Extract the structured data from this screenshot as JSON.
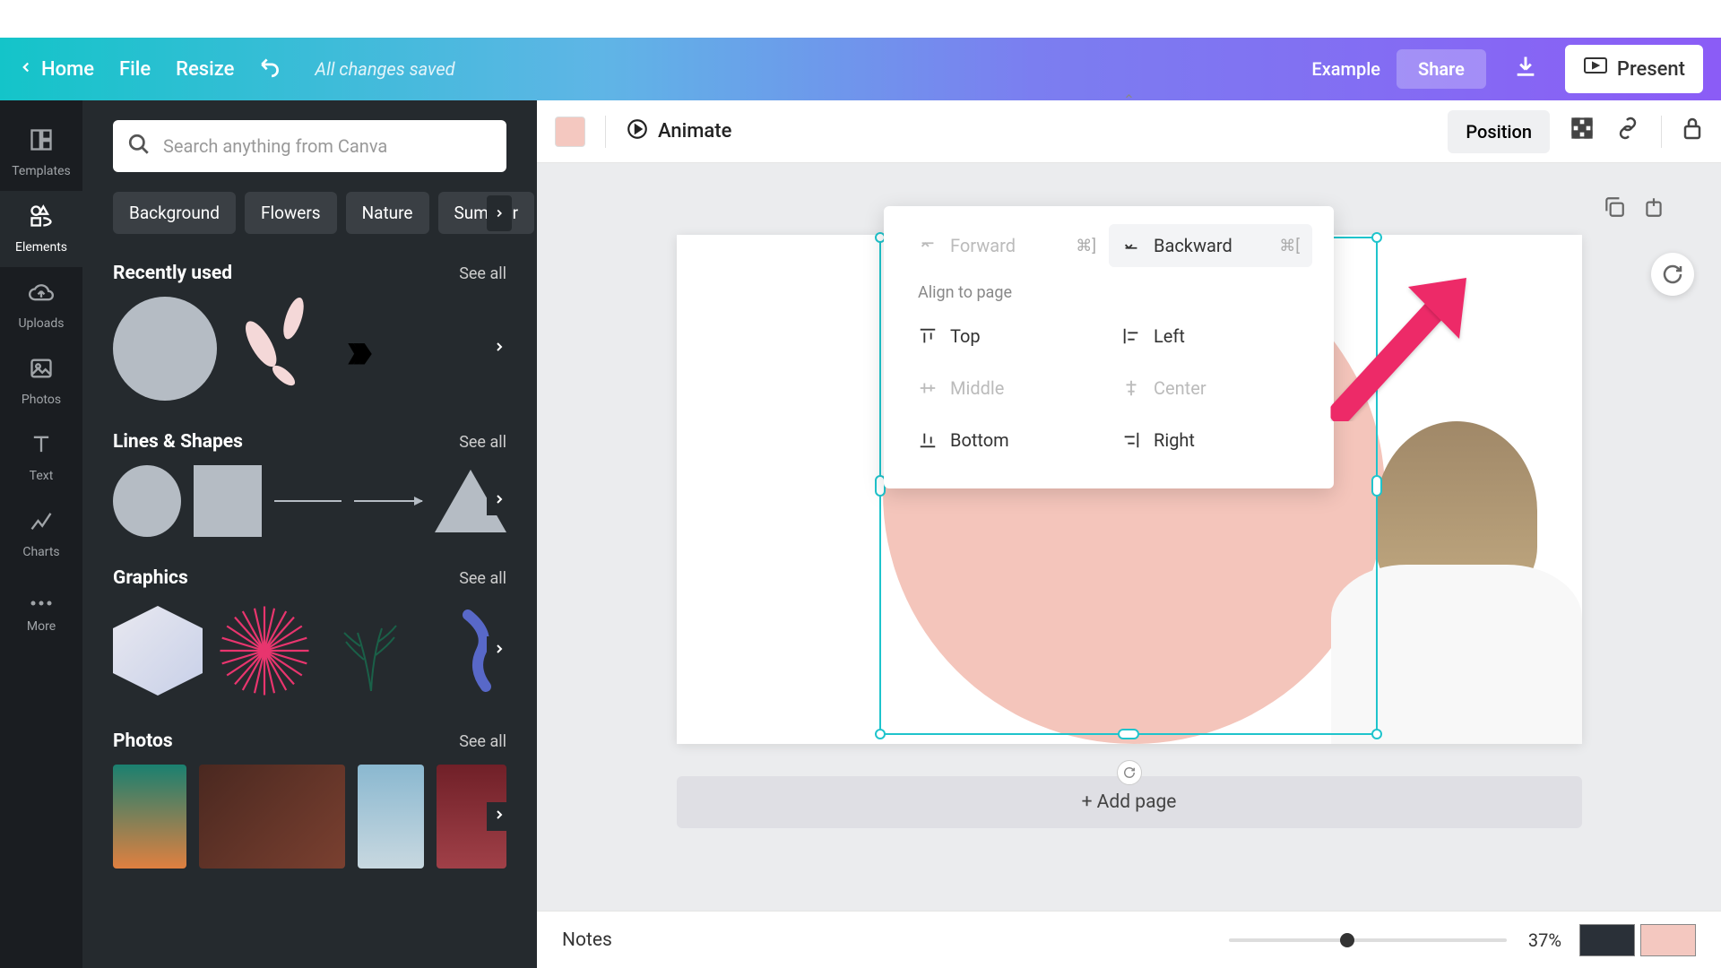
{
  "header": {
    "home": "Home",
    "file": "File",
    "resize": "Resize",
    "saved": "All changes saved",
    "example": "Example",
    "share": "Share",
    "present": "Present"
  },
  "nav": {
    "templates": "Templates",
    "elements": "Elements",
    "uploads": "Uploads",
    "photos": "Photos",
    "text": "Text",
    "charts": "Charts",
    "more": "More"
  },
  "panel": {
    "search_placeholder": "Search anything from Canva",
    "chips": [
      "Background",
      "Flowers",
      "Nature",
      "Summer"
    ],
    "see_all": "See all",
    "sections": {
      "recently_used": "Recently used",
      "lines_shapes": "Lines & Shapes",
      "graphics": "Graphics",
      "photos": "Photos"
    }
  },
  "toolbar": {
    "animate": "Animate",
    "position": "Position"
  },
  "position_popup": {
    "forward": "Forward",
    "forward_shortcut": "⌘]",
    "backward": "Backward",
    "backward_shortcut": "⌘[",
    "align_label": "Align to page",
    "top": "Top",
    "left": "Left",
    "middle": "Middle",
    "center": "Center",
    "bottom": "Bottom",
    "right": "Right"
  },
  "canvas": {
    "add_page": "+ Add page"
  },
  "bottom": {
    "notes": "Notes",
    "zoom": "37%"
  },
  "colors": {
    "selected_fill": "#f4c8c0"
  }
}
